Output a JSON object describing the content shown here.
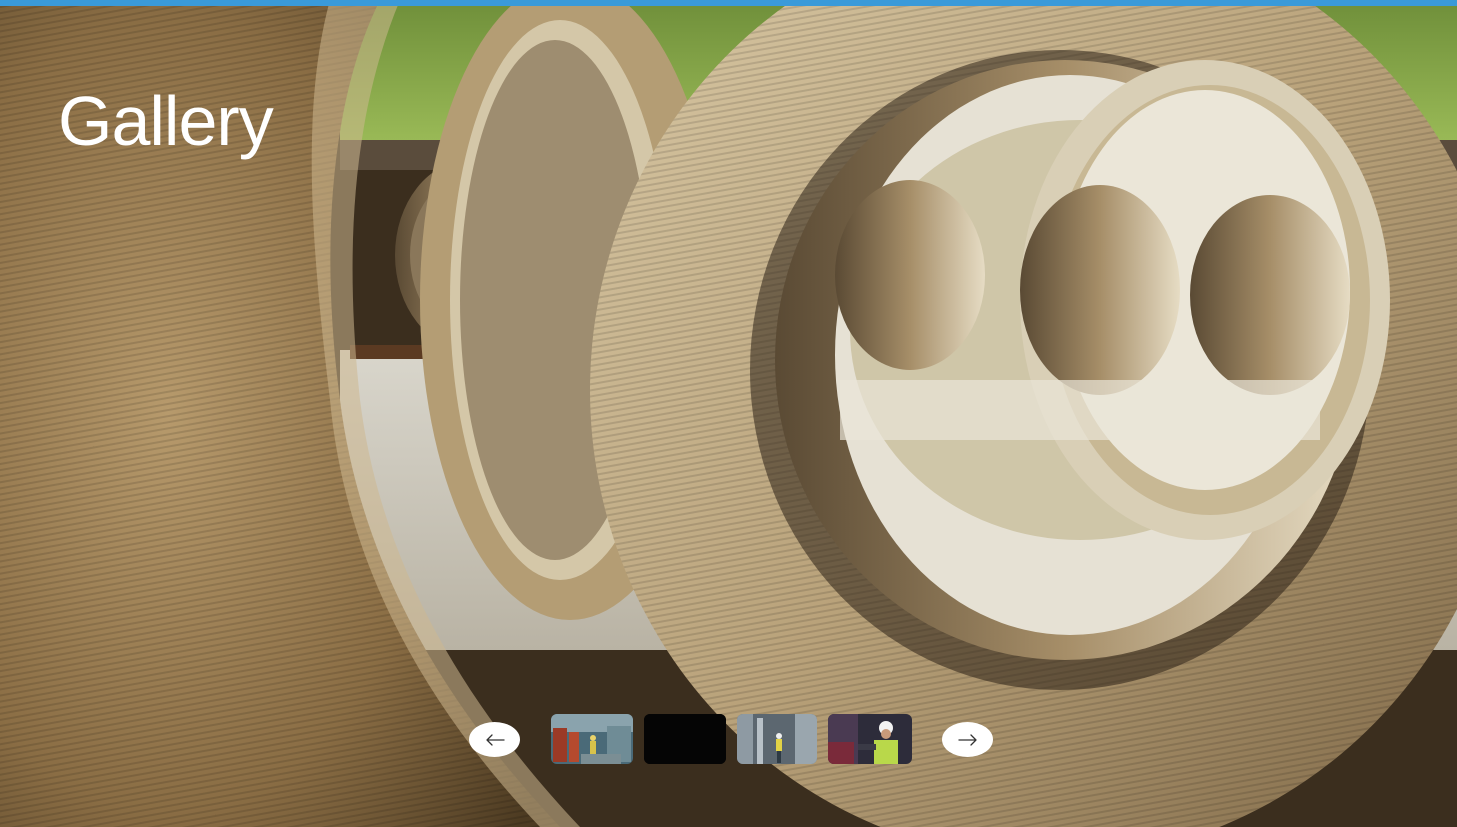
{
  "page": {
    "title": "Gallery"
  },
  "hero": {
    "icon": "pipes-photo",
    "accent_color": "#3a9ad9"
  },
  "carousel": {
    "prev_icon": "arrow-left-icon",
    "next_icon": "arrow-right-icon",
    "thumbnails": [
      {
        "icon": "warehouse-workers-thumbnail"
      },
      {
        "icon": "dark-thumbnail"
      },
      {
        "icon": "factory-worker-thumbnail"
      },
      {
        "icon": "engineer-helmet-thumbnail"
      }
    ]
  }
}
